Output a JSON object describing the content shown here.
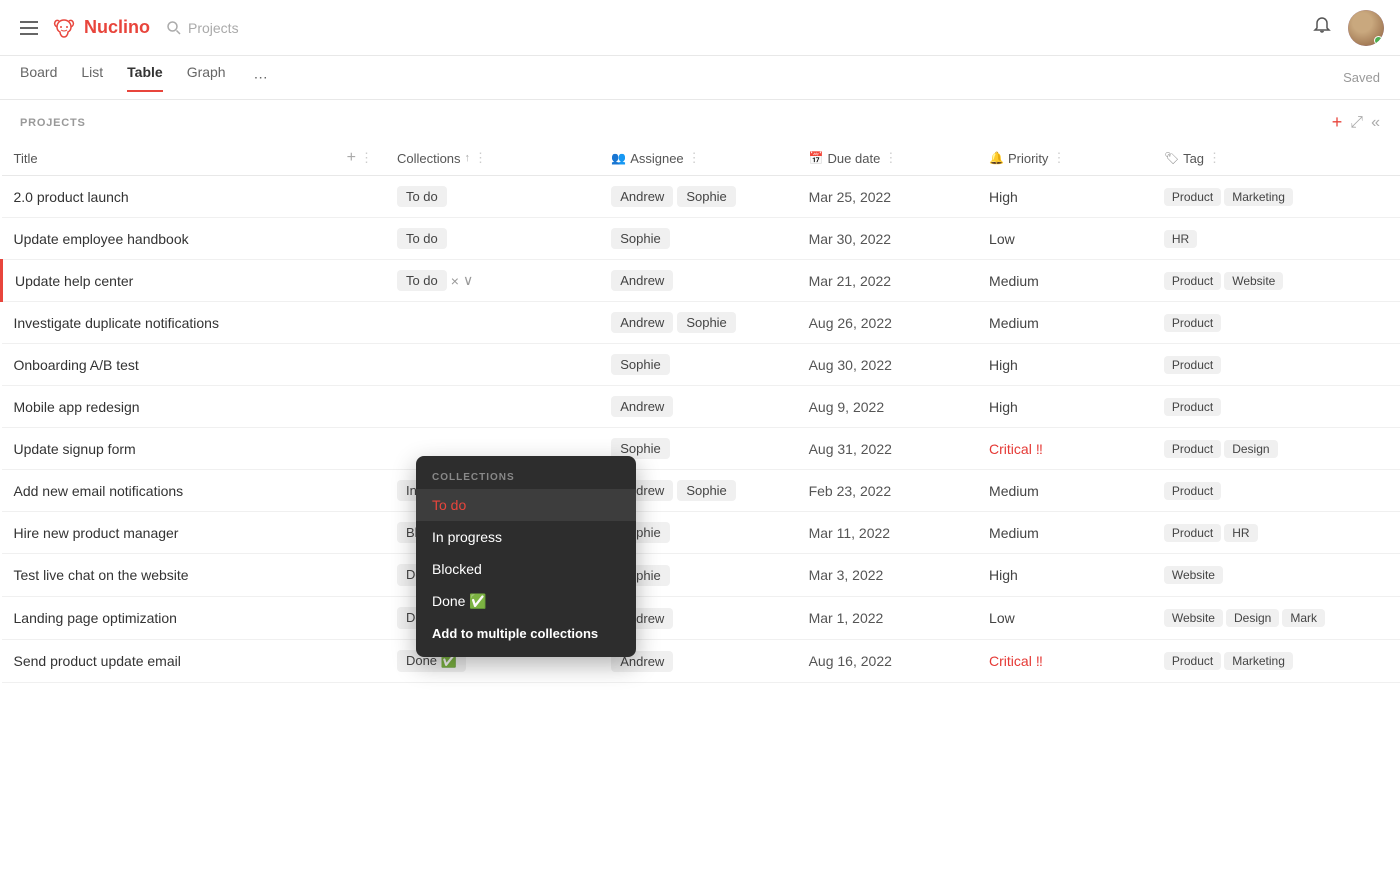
{
  "app": {
    "title": "Nuclino",
    "search_placeholder": "Projects"
  },
  "nav": {
    "tabs": [
      "Board",
      "List",
      "Table",
      "Graph"
    ],
    "active_tab": "Table",
    "more_icon": "⋯",
    "saved_label": "Saved"
  },
  "projects_section": {
    "title": "PROJECTS",
    "add_icon": "+",
    "expand_icon": "⤢",
    "collapse_icon": "«"
  },
  "table": {
    "columns": [
      {
        "id": "title",
        "label": "Title",
        "icon": null
      },
      {
        "id": "collections",
        "label": "Collections",
        "icon": null,
        "sortable": true
      },
      {
        "id": "assignee",
        "label": "Assignee",
        "icon": "👥"
      },
      {
        "id": "duedate",
        "label": "Due date",
        "icon": "📅"
      },
      {
        "id": "priority",
        "label": "Priority",
        "icon": "🔔"
      },
      {
        "id": "tag",
        "label": "Tag",
        "icon": "🏷"
      }
    ],
    "rows": [
      {
        "title": "2.0 product launch",
        "collections": "To do",
        "assignees": [
          "Andrew",
          "Sophie"
        ],
        "duedate": "Mar 25, 2022",
        "priority": "High",
        "priority_type": "normal",
        "tags": [
          "Product",
          "Marketing"
        ]
      },
      {
        "title": "Update employee handbook",
        "collections": "To do",
        "assignees": [
          "Sophie"
        ],
        "duedate": "Mar 30, 2022",
        "priority": "Low",
        "priority_type": "normal",
        "tags": [
          "HR"
        ]
      },
      {
        "title": "Update help center",
        "collections": "To do",
        "assignees": [
          "Andrew"
        ],
        "duedate": "Mar 21, 2022",
        "priority": "Medium",
        "priority_type": "normal",
        "tags": [
          "Product",
          "Website"
        ],
        "editing": true
      },
      {
        "title": "Investigate duplicate notifications",
        "collections": "",
        "assignees": [
          "Andrew",
          "Sophie"
        ],
        "duedate": "Aug 26, 2022",
        "priority": "Medium",
        "priority_type": "normal",
        "tags": [
          "Product"
        ]
      },
      {
        "title": "Onboarding A/B test",
        "collections": "",
        "assignees": [
          "Sophie"
        ],
        "duedate": "Aug 30, 2022",
        "priority": "High",
        "priority_type": "normal",
        "tags": [
          "Product"
        ]
      },
      {
        "title": "Mobile app redesign",
        "collections": "",
        "assignees": [
          "Andrew"
        ],
        "duedate": "Aug 9, 2022",
        "priority": "High",
        "priority_type": "normal",
        "tags": [
          "Product"
        ]
      },
      {
        "title": "Update signup form",
        "collections": "",
        "assignees": [
          "Sophie"
        ],
        "duedate": "Aug 31, 2022",
        "priority": "Critical",
        "priority_type": "critical",
        "tags": [
          "Product",
          "Design"
        ]
      },
      {
        "title": "Add new email notifications",
        "collections": "In progress",
        "assignees": [
          "Andrew",
          "Sophie"
        ],
        "duedate": "Feb 23, 2022",
        "priority": "Medium",
        "priority_type": "normal",
        "tags": [
          "Product"
        ]
      },
      {
        "title": "Hire new product manager",
        "collections": "Blocked",
        "assignees": [
          "Sophie"
        ],
        "duedate": "Mar 11, 2022",
        "priority": "Medium",
        "priority_type": "normal",
        "tags": [
          "Product",
          "HR"
        ]
      },
      {
        "title": "Test live chat on the website",
        "collections": "Done ✅",
        "assignees": [
          "Sophie"
        ],
        "duedate": "Mar 3, 2022",
        "priority": "High",
        "priority_type": "normal",
        "tags": [
          "Website"
        ]
      },
      {
        "title": "Landing page optimization",
        "collections": "Done ✅",
        "assignees": [
          "Andrew"
        ],
        "duedate": "Mar 1, 2022",
        "priority": "Low",
        "priority_type": "normal",
        "tags": [
          "Website",
          "Design",
          "Mark"
        ]
      },
      {
        "title": "Send product update email",
        "collections": "Done ✅",
        "assignees": [
          "Andrew"
        ],
        "duedate": "Aug 16, 2022",
        "priority": "Critical",
        "priority_type": "critical",
        "tags": [
          "Product",
          "Marketing"
        ]
      }
    ]
  },
  "dropdown": {
    "header": "COLLECTIONS",
    "items": [
      "To do",
      "In progress",
      "Blocked",
      "Done ✅"
    ],
    "selected": "To do",
    "add_multiple_label": "Add to multiple collections"
  }
}
